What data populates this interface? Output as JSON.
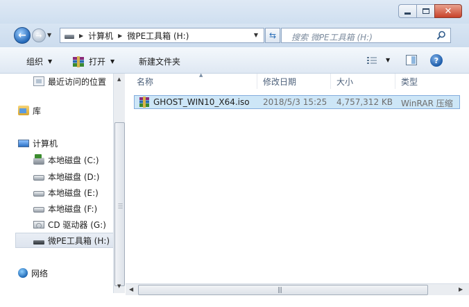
{
  "window": {
    "minimize_icon": "minimize-icon",
    "maximize_icon": "maximize-icon",
    "close_glyph": "✕"
  },
  "address": {
    "crumbs": [
      "计算机",
      "微PE工具箱 (H:)"
    ],
    "search_placeholder": "搜索 微PE工具箱 (H:)"
  },
  "toolbar": {
    "organize": "组织",
    "open": "打开",
    "new_folder": "新建文件夹"
  },
  "sidebar": {
    "items": [
      {
        "label": "最近访问的位置",
        "icon": "recent-places-icon"
      },
      {
        "label": "库",
        "icon": "library-icon"
      },
      {
        "label": "计算机",
        "icon": "computer-icon"
      },
      {
        "label": "本地磁盘 (C:)",
        "icon": "system-drive-icon"
      },
      {
        "label": "本地磁盘 (D:)",
        "icon": "drive-icon"
      },
      {
        "label": "本地磁盘 (E:)",
        "icon": "drive-icon"
      },
      {
        "label": "本地磁盘 (F:)",
        "icon": "drive-icon"
      },
      {
        "label": "CD 驱动器 (G:)",
        "icon": "cd-drive-icon"
      },
      {
        "label": "微PE工具箱 (H:)",
        "icon": "usb-drive-icon",
        "selected": true
      },
      {
        "label": "网络",
        "icon": "network-icon"
      }
    ]
  },
  "columns": {
    "name": "名称",
    "date": "修改日期",
    "size": "大小",
    "type": "类型"
  },
  "files": [
    {
      "name": "GHOST_WIN10_X64.iso",
      "date": "2018/5/3 15:25",
      "size": "4,757,312 KB",
      "type": "WinRAR 压缩"
    }
  ],
  "colors": {
    "selection": "#cde6f7",
    "selection_border": "#84acdd",
    "accent": "#2468b8",
    "close": "#c8422a"
  }
}
